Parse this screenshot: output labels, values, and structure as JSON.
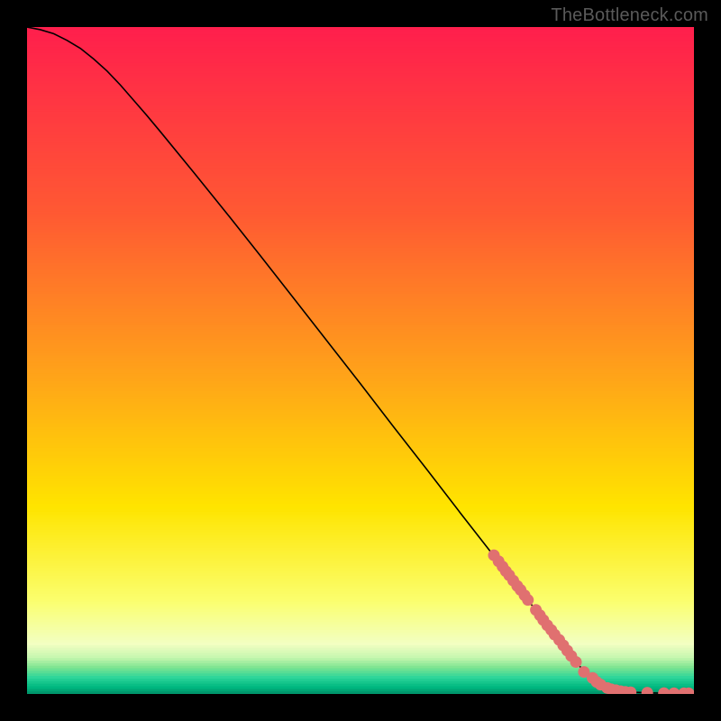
{
  "watermark": "TheBottleneck.com",
  "colors": {
    "top": "#ff1f4d",
    "mid": "#ffdd00",
    "bottom_band_start": "#f7ffc0",
    "bottom_band_mid": "#8fe88f",
    "bottom_band_end": "#00d38a",
    "very_bottom": "#00a060",
    "point": "#e07070",
    "curve": "#000000"
  },
  "chart_data": {
    "type": "line",
    "title": "",
    "xlabel": "",
    "ylabel": "",
    "xlim": [
      0,
      100
    ],
    "ylim": [
      0,
      100
    ],
    "curve": [
      {
        "x": 0,
        "y": 100.0
      },
      {
        "x": 2,
        "y": 99.6
      },
      {
        "x": 4,
        "y": 99.0
      },
      {
        "x": 6,
        "y": 98.0
      },
      {
        "x": 8,
        "y": 96.8
      },
      {
        "x": 10,
        "y": 95.2
      },
      {
        "x": 12,
        "y": 93.4
      },
      {
        "x": 14,
        "y": 91.3
      },
      {
        "x": 16,
        "y": 89.0
      },
      {
        "x": 18,
        "y": 86.7
      },
      {
        "x": 20,
        "y": 84.3
      },
      {
        "x": 25,
        "y": 78.2
      },
      {
        "x": 30,
        "y": 72.0
      },
      {
        "x": 35,
        "y": 65.7
      },
      {
        "x": 40,
        "y": 59.3
      },
      {
        "x": 45,
        "y": 52.9
      },
      {
        "x": 50,
        "y": 46.5
      },
      {
        "x": 55,
        "y": 40.0
      },
      {
        "x": 60,
        "y": 33.6
      },
      {
        "x": 65,
        "y": 27.1
      },
      {
        "x": 70,
        "y": 20.7
      },
      {
        "x": 75,
        "y": 14.2
      },
      {
        "x": 80,
        "y": 7.8
      },
      {
        "x": 83,
        "y": 4.0
      },
      {
        "x": 85,
        "y": 2.2
      },
      {
        "x": 87,
        "y": 1.0
      },
      {
        "x": 89,
        "y": 0.5
      },
      {
        "x": 91,
        "y": 0.25
      },
      {
        "x": 94,
        "y": 0.15
      },
      {
        "x": 97,
        "y": 0.1
      },
      {
        "x": 100,
        "y": 0.1
      }
    ],
    "points": [
      {
        "x": 70.0,
        "y": 20.8
      },
      {
        "x": 70.7,
        "y": 19.9
      },
      {
        "x": 71.3,
        "y": 19.1
      },
      {
        "x": 71.8,
        "y": 18.4
      },
      {
        "x": 72.3,
        "y": 17.8
      },
      {
        "x": 72.9,
        "y": 17.0
      },
      {
        "x": 73.5,
        "y": 16.2
      },
      {
        "x": 74.0,
        "y": 15.6
      },
      {
        "x": 74.6,
        "y": 14.8
      },
      {
        "x": 75.1,
        "y": 14.1
      },
      {
        "x": 76.3,
        "y": 12.6
      },
      {
        "x": 76.9,
        "y": 11.8
      },
      {
        "x": 77.4,
        "y": 11.1
      },
      {
        "x": 78.0,
        "y": 10.3
      },
      {
        "x": 78.6,
        "y": 9.6
      },
      {
        "x": 79.1,
        "y": 8.9
      },
      {
        "x": 79.8,
        "y": 8.1
      },
      {
        "x": 80.4,
        "y": 7.3
      },
      {
        "x": 81.0,
        "y": 6.5
      },
      {
        "x": 81.6,
        "y": 5.7
      },
      {
        "x": 82.3,
        "y": 4.8
      },
      {
        "x": 83.5,
        "y": 3.3
      },
      {
        "x": 84.8,
        "y": 2.4
      },
      {
        "x": 85.4,
        "y": 1.8
      },
      {
        "x": 86.0,
        "y": 1.4
      },
      {
        "x": 87.0,
        "y": 0.9
      },
      {
        "x": 87.6,
        "y": 0.7
      },
      {
        "x": 88.3,
        "y": 0.55
      },
      {
        "x": 89.0,
        "y": 0.4
      },
      {
        "x": 89.7,
        "y": 0.3
      },
      {
        "x": 90.5,
        "y": 0.25
      },
      {
        "x": 93.0,
        "y": 0.18
      },
      {
        "x": 95.5,
        "y": 0.12
      },
      {
        "x": 97.0,
        "y": 0.1
      },
      {
        "x": 98.5,
        "y": 0.1
      },
      {
        "x": 99.2,
        "y": 0.1
      }
    ]
  }
}
